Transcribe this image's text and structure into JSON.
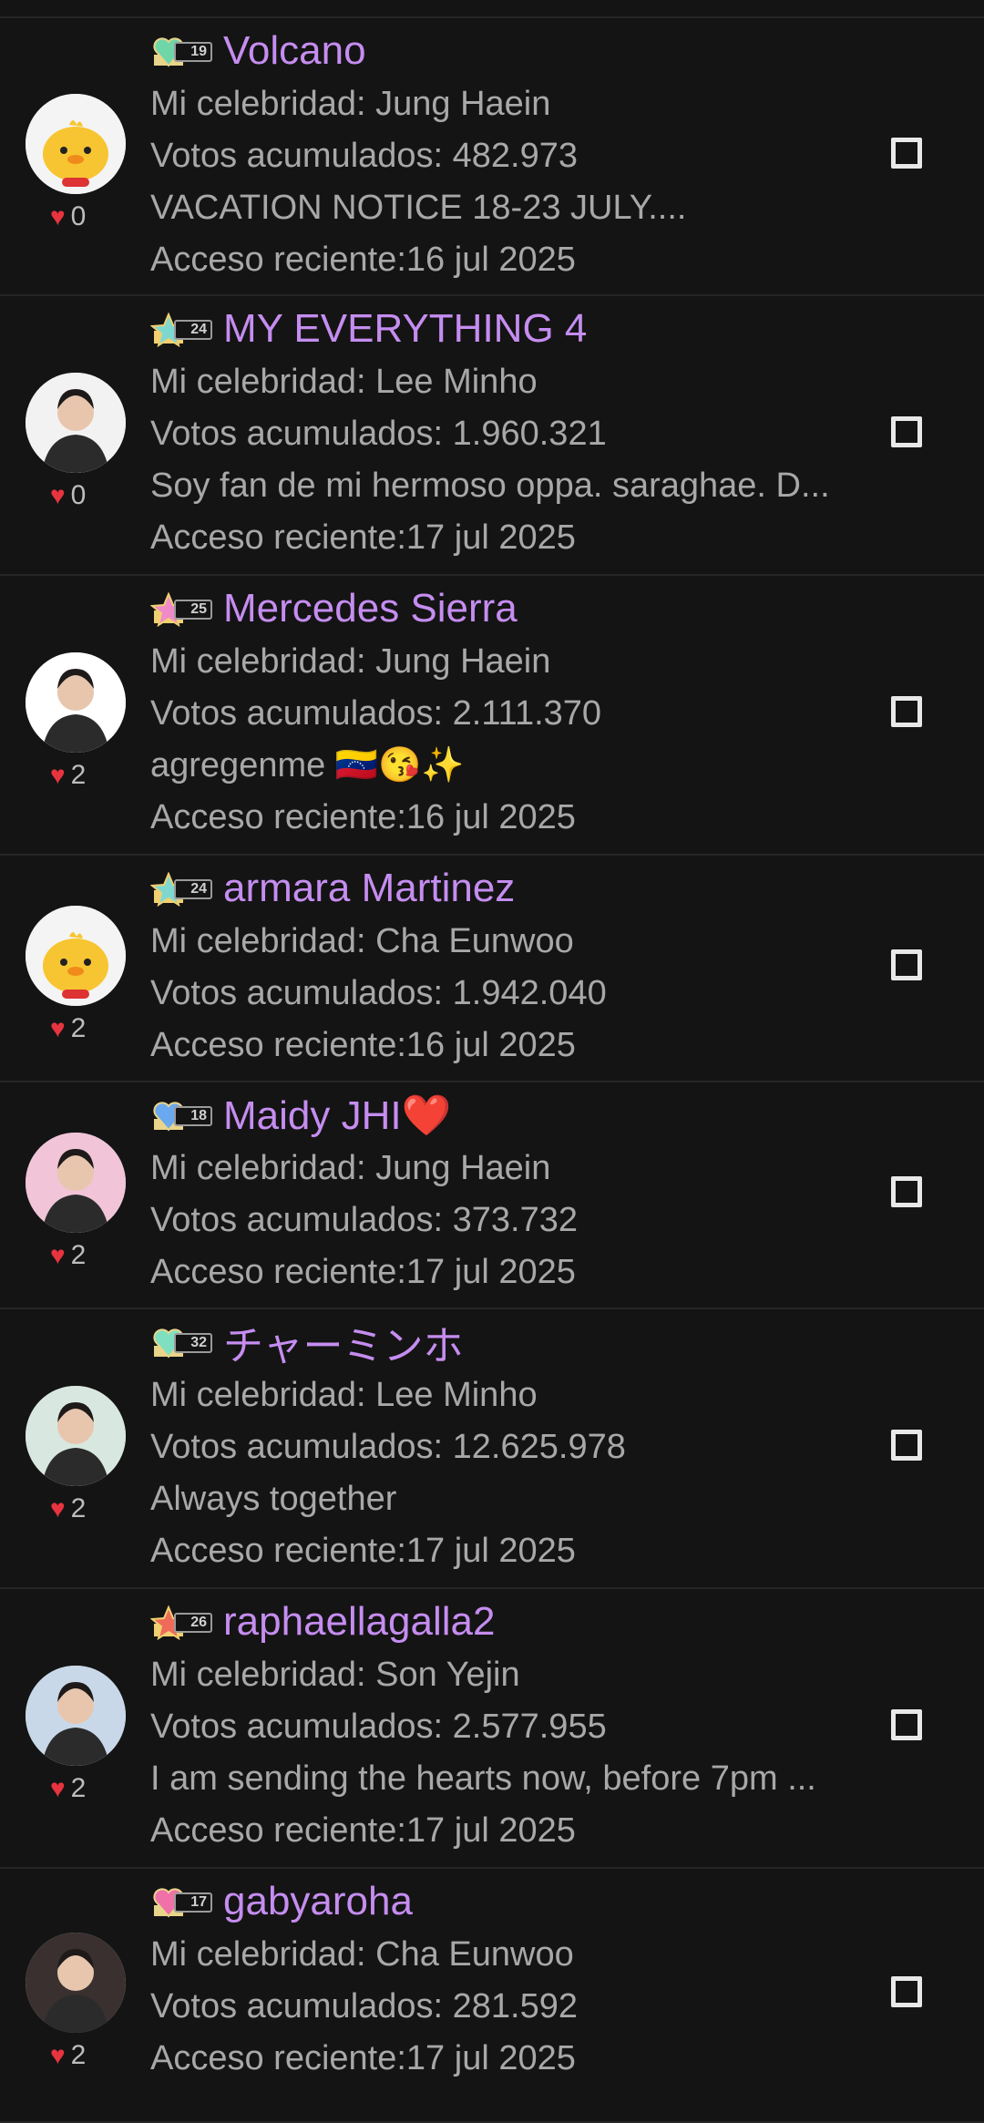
{
  "labels": {
    "celebrity_prefix": "Mi celebridad: ",
    "votes_prefix": "Votos acumulados: ",
    "access_prefix": "Acceso reciente:"
  },
  "colors": {
    "background": "#141414",
    "name": "#c58df0",
    "text": "#a8a8a8",
    "heart": "#e8343f",
    "divider": "#262626"
  },
  "users": [
    {
      "name": "Volcano",
      "level": "19",
      "badge": "green-heart-badge",
      "celebrity": "Jung Haein",
      "votes": "482.973",
      "message": "VACATION NOTICE 18-23 JULY....",
      "access": "16 jul 2025",
      "likes": "0",
      "avatar": "chick-avatar"
    },
    {
      "name": "MY EVERYTHING 4",
      "level": "24",
      "badge": "teal-star-badge",
      "celebrity": "Lee Minho",
      "votes": "1.960.321",
      "message": "Soy fan de mi hermoso oppa. saraghae. D...",
      "access": "17 jul 2025",
      "likes": "0",
      "avatar": "photo-avatar"
    },
    {
      "name": "Mercedes Sierra",
      "level": "25",
      "badge": "pink-star-badge",
      "celebrity": "Jung Haein",
      "votes": "2.111.370",
      "message": "agregenme 🇻🇪😘✨",
      "access": "16 jul 2025",
      "likes": "2",
      "avatar": "photo-avatar"
    },
    {
      "name": "armara Martinez",
      "level": "24",
      "badge": "teal-star-badge",
      "celebrity": "Cha Eunwoo",
      "votes": "1.942.040",
      "message": "",
      "access": "16 jul 2025",
      "likes": "2",
      "avatar": "chick-avatar"
    },
    {
      "name": "Maidy JHI❤️",
      "level": "18",
      "badge": "blue-heart-badge",
      "celebrity": "Jung Haein",
      "votes": "373.732",
      "message": "",
      "access": "17 jul 2025",
      "likes": "2",
      "avatar": "photo-avatar"
    },
    {
      "name": "チャーミンホ",
      "level": "32",
      "badge": "mint-heart-badge",
      "celebrity": "Lee Minho",
      "votes": "12.625.978",
      "message": "Always together",
      "access": "17 jul 2025",
      "likes": "2",
      "avatar": "photo-avatar"
    },
    {
      "name": "raphaellagalla2",
      "level": "26",
      "badge": "red-star-badge",
      "celebrity": "Son Yejin",
      "votes": "2.577.955",
      "message": "I am sending the hearts now, before 7pm ...",
      "access": "17 jul 2025",
      "likes": "2",
      "avatar": "photo-avatar"
    },
    {
      "name": "gabyaroha",
      "level": "17",
      "badge": "pink-heart-badge",
      "celebrity": "Cha Eunwoo",
      "votes": "281.592",
      "message": "",
      "access": "17 jul 2025",
      "likes": "2",
      "avatar": "photo-avatar"
    }
  ]
}
